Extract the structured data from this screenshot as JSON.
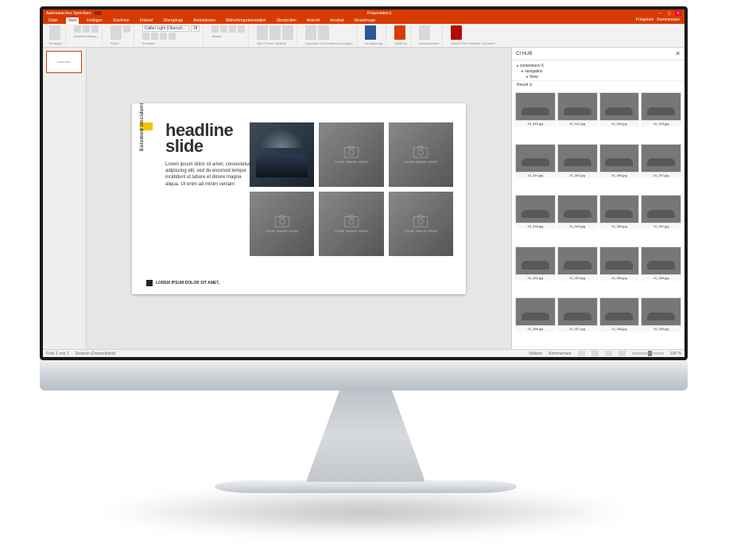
{
  "window": {
    "app_label": "Automatisches Speichern",
    "title": "Präsentation1",
    "share": "Freigeben",
    "comments": "Kommentare",
    "min": "–",
    "max": "▢",
    "close": "✕"
  },
  "tabs": [
    "Datei",
    "Start",
    "Einfügen",
    "Zeichnen",
    "Entwurf",
    "Übergänge",
    "Animationen",
    "Bildschirmpräsentation",
    "Überprüfen",
    "Ansicht",
    "Acrobat",
    "Smartimage"
  ],
  "active_tab": 1,
  "ribbon": {
    "g0": "Einfügen",
    "g1": "Zwischenablage",
    "g2": "Folien",
    "g3": "Schriftart",
    "g4": "Absatz",
    "g5": "Zeichnung",
    "g6": "Bild  Formen  Textfeld",
    "g7": "anordnen  Schnellformat-vorlagen",
    "g8": "Formgebung",
    "g9": "Diktieren",
    "g10": "Vertraulichkeit",
    "g11": "Adobe PDF erstellen und teilen",
    "font_name": "Calibri Light (Übersch…",
    "font_size": "18"
  },
  "thumbnail": {
    "label": "Power Point"
  },
  "slide": {
    "sidelabel": "Euismod tincidunt",
    "headline1": "headline",
    "headline2": "slide",
    "body": "Lorem ipsum dolor sit amet, consectetur adipiscing elit, sed do eiusmod tempor incididunt ut labore et dolore magna aliqua. Ut enim ad minim veniam",
    "footer": "LOREM IPSUM DOLOR SIT AMET,",
    "placeholder": "YOUR IMAGE HERE"
  },
  "panel": {
    "title": "CI HUB",
    "close": "✕",
    "tree": [
      "contentserv",
      "navigation",
      "View"
    ],
    "tree_count": "5",
    "search": "Result ①",
    "assets": [
      "10_340.jpg",
      "10_341.jpg",
      "10_342.jpg",
      "10_343.jpg",
      "10_344.jpg",
      "10_345.jpg",
      "10_346.jpg",
      "10_347.jpg",
      "10_348.jpg",
      "10_349.jpg",
      "10_350.jpg",
      "10_351.jpg",
      "10_352.jpg",
      "10_353.jpg",
      "10_354.jpg",
      "10_355.jpg",
      "10_356.jpg",
      "10_357.jpg",
      "10_358.jpg",
      "10_359.jpg"
    ]
  },
  "status": {
    "left1": "Folie 1 von 1",
    "left2": "Deutsch (Deutschland)",
    "notes": "Notizen",
    "comments": "Kommentare",
    "zoom": "100 %"
  }
}
